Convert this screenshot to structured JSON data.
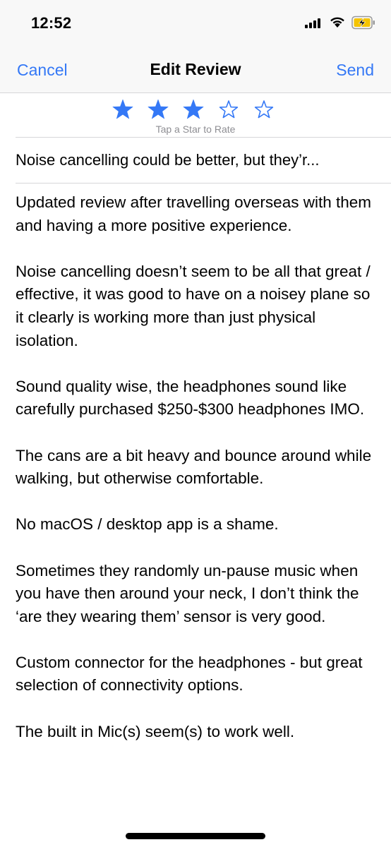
{
  "status_bar": {
    "time": "12:52",
    "icons": [
      "cellular-signal-icon",
      "wifi-icon",
      "battery-charging-icon"
    ]
  },
  "nav": {
    "cancel_label": "Cancel",
    "title": "Edit Review",
    "send_label": "Send"
  },
  "rating": {
    "value": 3,
    "max": 5,
    "hint": "Tap a Star to Rate"
  },
  "review": {
    "title": "Noise cancelling could be better, but they’r...",
    "paragraphs": [
      "Updated review after travelling overseas with them and having a more positive experience.",
      "Noise cancelling doesn’t seem to be all that great / effective, it was good to have on a noisey plane so it clearly is working more than just physical isolation.",
      "Sound quality wise, the headphones sound like carefully purchased $250-$300 headphones IMO.",
      "The cans are a bit heavy and bounce around while walking, but otherwise comfortable.",
      "No macOS / desktop app is a shame.",
      "Sometimes they randomly un-pause music when you have then around your neck, I don’t think the ‘are they wearing them’ sensor is very good.",
      "Custom connector for the headphones - but great selection of connectivity options.",
      "The built in Mic(s) seem(s) to work well."
    ]
  },
  "colors": {
    "accent": "#3478f6",
    "hint_gray": "#8e8e93",
    "bar_background": "#f8f8f8",
    "separator": "#d6d6d9",
    "battery_fill": "#f5c400"
  }
}
